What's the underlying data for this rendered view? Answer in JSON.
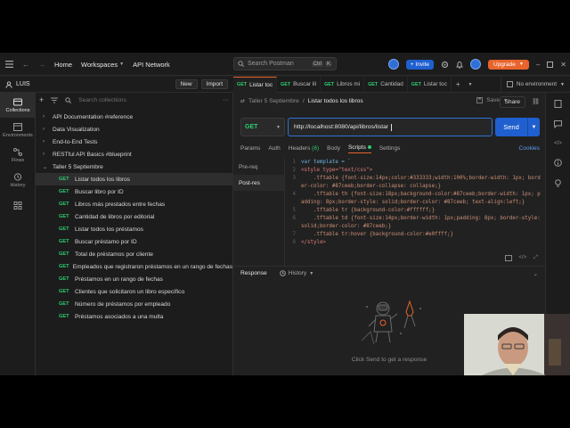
{
  "topbar": {
    "nav": [
      "Home",
      "Workspaces",
      "API Network"
    ],
    "search_placeholder": "Search Postman",
    "shortcut": [
      "Ctrl",
      "K"
    ],
    "invite_label": "Invite",
    "upgrade_label": "Upgrade",
    "environment": "No environment"
  },
  "workspace": {
    "name": "LUIS",
    "new_label": "New",
    "import_label": "Import"
  },
  "rail": [
    {
      "label": "Collections",
      "icon": "collections-icon",
      "active": true
    },
    {
      "label": "Environments",
      "icon": "environments-icon",
      "active": false
    },
    {
      "label": "Flows",
      "icon": "flows-icon",
      "active": false
    },
    {
      "label": "History",
      "icon": "history-icon",
      "active": false
    },
    {
      "label": "",
      "icon": "apps-icon",
      "active": false
    }
  ],
  "sidebar": {
    "search_placeholder": "Search collections",
    "collections": [
      "API Documentation #reference",
      "Data Visualization",
      "End-to-End Tests",
      "RESTful API Basics #blueprint"
    ],
    "open_collection": "Taller 5 Septiembre",
    "method": "GET",
    "requests": [
      "Listar todos los libros",
      "Buscar libro por ID",
      "Libros más prestados entre fechas",
      "Cantidad de libros por editorial",
      "Listar todos los préstamos",
      "Buscar préstamo por ID",
      "Total de préstamos por cliente",
      "Empleados que registraron préstamos en un rango de fechas",
      "Préstamos en un rango de fechas",
      "Clientes que solicitaron un libro específico",
      "Número de préstamos por empleado",
      "Préstamos asociados a una multa"
    ]
  },
  "tabs": [
    {
      "method": "GET",
      "label": "Listar toc",
      "active": true
    },
    {
      "method": "GET",
      "label": "Buscar lil",
      "active": false
    },
    {
      "method": "GET",
      "label": "Libros mi",
      "active": false
    },
    {
      "method": "GET",
      "label": "Cantidad",
      "active": false
    },
    {
      "method": "GET",
      "label": "Listar toc",
      "active": false
    }
  ],
  "request": {
    "breadcrumb_parent": "Taller 5 Septiembre",
    "breadcrumb_current": "Listar todos los libros",
    "save_label": "Save",
    "share_label": "Share",
    "method": "GET",
    "url": "http://localhost:8080/api/libros/listar",
    "send_label": "Send",
    "subtabs": {
      "params": "Params",
      "auth": "Auth",
      "headers": "Headers",
      "headers_count": "(6)",
      "body": "Body",
      "scripts": "Scripts",
      "settings": "Settings",
      "cookies": "Cookies"
    },
    "script_sections": [
      "Pre-req",
      "Post-res"
    ],
    "code": [
      {
        "n": "1",
        "t": "var template = `"
      },
      {
        "n": "2",
        "t": "<style type=\"text/css\">"
      },
      {
        "n": "3",
        "t": "    .tftable {font-size:14px;color:#333333;width:100%;border-width: 1px; border-color: #87ceeb;border-collapse: collapse;}"
      },
      {
        "n": "4",
        "t": "    .tftable th {font-size:18px;background-color:#87ceeb;border-width: 1px; padding: 8px;border-style: solid;border-color: #87ceeb; text-align:left;}"
      },
      {
        "n": "5",
        "t": "    .tftable tr {background-color:#ffffff;}"
      },
      {
        "n": "6",
        "t": "    .tftable td {font-size:14px;border-width: 1px;padding: 8px; border-style: solid;border-color: #87ceeb;}"
      },
      {
        "n": "7",
        "t": "    .tftable tr:hover {background-color:#e0ffff;}"
      },
      {
        "n": "8",
        "t": "</style>"
      }
    ]
  },
  "response": {
    "tab_response": "Response",
    "tab_history": "History",
    "hint": "Click Send to get a response"
  },
  "colors": {
    "accent_orange": "#e8642c",
    "primary_blue": "#1f5fcf",
    "get_green": "#2ecc71"
  }
}
